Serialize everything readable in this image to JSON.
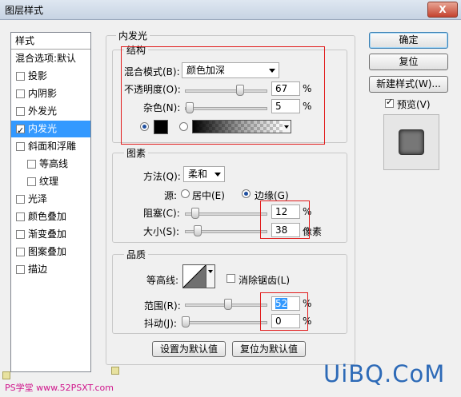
{
  "window": {
    "title": "图层样式",
    "close": "X"
  },
  "left": {
    "header": "样式",
    "items": [
      {
        "label": "混合选项:默认",
        "checkbox": false,
        "checked": false,
        "indent": 0
      },
      {
        "label": "投影",
        "checkbox": true,
        "checked": false,
        "indent": 0
      },
      {
        "label": "内阴影",
        "checkbox": true,
        "checked": false,
        "indent": 0
      },
      {
        "label": "外发光",
        "checkbox": true,
        "checked": false,
        "indent": 0
      },
      {
        "label": "内发光",
        "checkbox": true,
        "checked": true,
        "indent": 0,
        "selected": true
      },
      {
        "label": "斜面和浮雕",
        "checkbox": true,
        "checked": false,
        "indent": 0
      },
      {
        "label": "等高线",
        "checkbox": true,
        "checked": false,
        "indent": 1
      },
      {
        "label": "纹理",
        "checkbox": true,
        "checked": false,
        "indent": 1
      },
      {
        "label": "光泽",
        "checkbox": true,
        "checked": false,
        "indent": 0
      },
      {
        "label": "颜色叠加",
        "checkbox": true,
        "checked": false,
        "indent": 0
      },
      {
        "label": "渐变叠加",
        "checkbox": true,
        "checked": false,
        "indent": 0
      },
      {
        "label": "图案叠加",
        "checkbox": true,
        "checked": false,
        "indent": 0
      },
      {
        "label": "描边",
        "checkbox": true,
        "checked": false,
        "indent": 0
      }
    ]
  },
  "main": {
    "group_title": "内发光",
    "structure": {
      "title": "结构",
      "blend_label": "混合模式(B):",
      "blend_value": "颜色加深",
      "opacity_label": "不透明度(O):",
      "opacity_value": "67",
      "opacity_level": 67,
      "noise_label": "杂色(N):",
      "noise_value": "5",
      "noise_level": 5,
      "unit": "%",
      "color_mode": "solid",
      "solid_color": "#000000"
    },
    "elements": {
      "title": "图素",
      "method_label": "方法(Q):",
      "method_value": "柔和",
      "source_label": "源:",
      "source_center": "居中(E)",
      "source_edge": "边缘(G)",
      "source_selected": "edge",
      "choke_label": "阻塞(C):",
      "choke_value": "12",
      "choke_level": 12,
      "size_label": "大小(S):",
      "size_value": "38",
      "size_level": 15,
      "unit": "%",
      "size_unit": "像素"
    },
    "quality": {
      "title": "品质",
      "contour_label": "等高线:",
      "antialias_label": "消除锯齿(L)",
      "range_label": "范围(R):",
      "range_value": "52",
      "range_level": 52,
      "jitter_label": "抖动(J):",
      "jitter_value": "0",
      "jitter_level": 0,
      "unit": "%"
    },
    "reset_default": "设置为默认值",
    "restore_default": "复位为默认值"
  },
  "right": {
    "ok": "确定",
    "reset": "复位",
    "new_style": "新建样式(W)...",
    "preview_label": "预览(V)",
    "preview_checked": true
  },
  "watermark": {
    "left": "PS学堂 www.52PSXT.com",
    "right": "UiBQ.CoM"
  },
  "colors": {
    "highlight": "#3399ff",
    "annotation": "#e11b1b"
  }
}
